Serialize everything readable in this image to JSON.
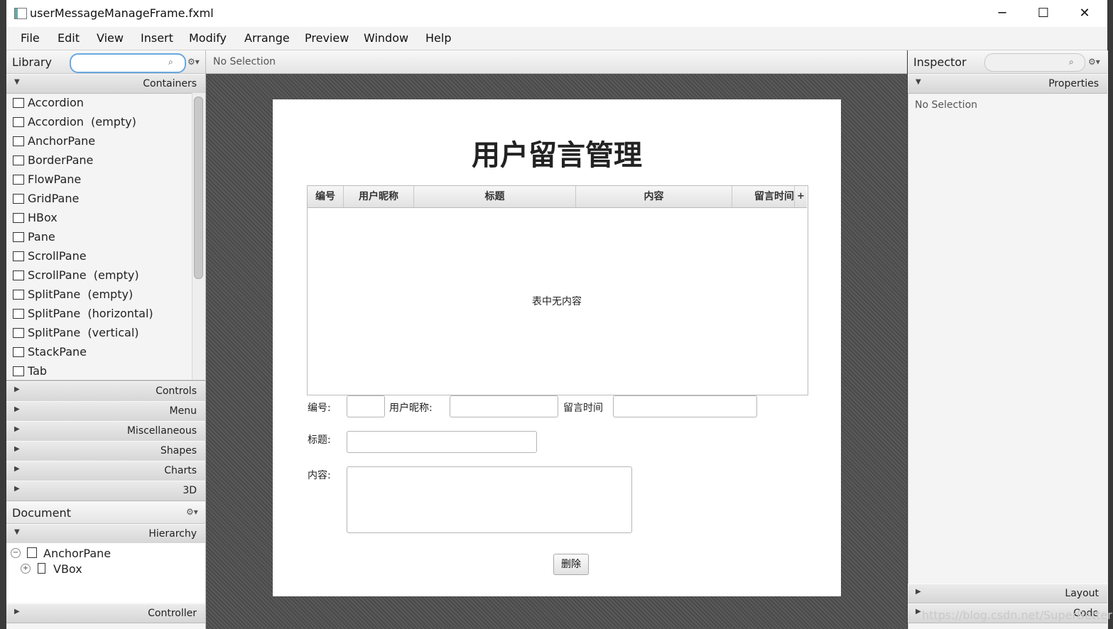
{
  "window": {
    "title": "userMessageManageFrame.fxml",
    "minimize": "─",
    "maximize": "☐",
    "close": "✕"
  },
  "menu": {
    "file": "File",
    "edit": "Edit",
    "view": "View",
    "insert": "Insert",
    "modify": "Modify",
    "arrange": "Arrange",
    "preview": "Preview",
    "window": "Window",
    "help": "Help"
  },
  "library": {
    "title": "Library",
    "search_placeholder": "",
    "containers_label": "Containers",
    "items": [
      "Accordion",
      "Accordion  (empty)",
      "AnchorPane",
      "BorderPane",
      "FlowPane",
      "GridPane",
      "HBox",
      "Pane",
      "ScrollPane",
      "ScrollPane  (empty)",
      "SplitPane  (empty)",
      "SplitPane  (horizontal)",
      "SplitPane  (vertical)",
      "StackPane",
      "Tab"
    ],
    "sections": [
      "Controls",
      "Menu",
      "Miscellaneous",
      "Shapes",
      "Charts",
      "3D"
    ]
  },
  "document": {
    "title": "Document",
    "hierarchy_label": "Hierarchy",
    "tree": [
      {
        "label": "AnchorPane",
        "toggle": "−"
      },
      {
        "label": "VBox",
        "toggle": "+"
      }
    ],
    "controller_label": "Controller"
  },
  "center": {
    "selection_text": "No Selection"
  },
  "form": {
    "title": "用户留言管理",
    "columns": [
      "编号",
      "用户昵称",
      "标题",
      "内容",
      "留言时间"
    ],
    "add_column": "+",
    "empty_placeholder": "表中无内容",
    "id_label": "编号:",
    "nickname_label": "用户昵称:",
    "time_label": "留言时间",
    "title_label": "标题:",
    "content_label": "内容:",
    "delete_button": "删除"
  },
  "inspector": {
    "title": "Inspector",
    "properties_label": "Properties",
    "selection_text": "No Selection",
    "layout_label": "Layout",
    "code_label": "Code"
  },
  "watermark": "https://blog.csdn.net/SuperBetterMan",
  "icons": {
    "search": "search-icon",
    "gear": "gear-icon"
  },
  "colors": {
    "accent_focus": "#69a8e0",
    "canvas": "#4f4f4f"
  }
}
